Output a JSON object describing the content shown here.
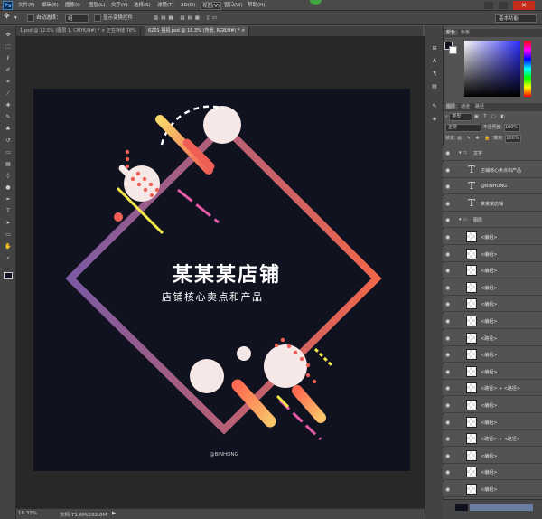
{
  "menubar": {
    "logo": "Ps",
    "items": [
      "文件(F)",
      "编辑(E)",
      "图像(I)",
      "图层(L)",
      "文字(Y)",
      "选择(S)",
      "滤镜(T)",
      "3D(D)",
      "视图(V)",
      "窗口(W)",
      "帮助(H)"
    ],
    "active_index": 8,
    "close": "✕"
  },
  "options": {
    "auto_select_label": "自动选择：",
    "auto_select_value": "组",
    "show_transform_label": "显示变换控件",
    "workspace": "基本功能"
  },
  "tabs": [
    {
      "label": "1.psd @ 12.5% (图层 1, CMYK/8#) * ×",
      "active": false
    },
    {
      "label": "正在存储 78%",
      "active": false
    },
    {
      "label": "6201 招招.psd @ 18.3% (背景, RGB/8#) * ×",
      "active": true
    }
  ],
  "status": {
    "zoom": "18.33%",
    "doc": "文档:71.6M/282.8M",
    "arrow": "▶"
  },
  "artwork": {
    "title": "某某某店铺",
    "subtitle": "店铺核心卖点和产品",
    "brand": "@BINHONG"
  },
  "colors": {
    "artwork_bg": "#101220",
    "gradient_start": "#7b5aa3",
    "gradient_end": "#f0664a",
    "accent_yellow": "#f4e84a",
    "accent_pink": "#e85aa8",
    "accent_coral": "#ef5f55",
    "circle_fill": "#f6e8e6"
  },
  "panels": {
    "color_tabs": [
      "颜色",
      "色板"
    ],
    "layers_tabs": [
      "图层",
      "通道",
      "路径"
    ],
    "kind_filter": "类型",
    "blend_mode": "正常",
    "opacity_label": "不透明度:",
    "opacity_value": "100%",
    "lock_label": "锁定:",
    "fill_label": "填充:",
    "fill_value": "100%"
  },
  "layers": [
    {
      "name": "文字",
      "type": "group"
    },
    {
      "name": "店铺核心卖点和产品",
      "type": "text"
    },
    {
      "name": "@BINHONG",
      "type": "text"
    },
    {
      "name": "某某某店铺",
      "type": "text"
    },
    {
      "name": "图层",
      "type": "group"
    },
    {
      "name": "<编组>",
      "type": "shape"
    },
    {
      "name": "<编组>",
      "type": "shape"
    },
    {
      "name": "<编组>",
      "type": "shape"
    },
    {
      "name": "<编组>",
      "type": "shape"
    },
    {
      "name": "<编组>",
      "type": "shape"
    },
    {
      "name": "<编组>",
      "type": "shape"
    },
    {
      "name": "<路径>",
      "type": "shape"
    },
    {
      "name": "<编组>",
      "type": "shape"
    },
    {
      "name": "<编组>",
      "type": "shape"
    },
    {
      "name": "<路径> + <路径>",
      "type": "shape"
    },
    {
      "name": "<编组>",
      "type": "shape"
    },
    {
      "name": "<编组>",
      "type": "shape"
    },
    {
      "name": "<路径> + <路径>",
      "type": "shape"
    },
    {
      "name": "<编组>",
      "type": "shape"
    },
    {
      "name": "<编组>",
      "type": "shape"
    },
    {
      "name": "<编组>",
      "type": "shape"
    }
  ],
  "toolbox_icons": [
    "move-icon",
    "marquee-icon",
    "lasso-icon",
    "quick-select-icon",
    "crop-icon",
    "eyedropper-icon",
    "healing-icon",
    "brush-icon",
    "stamp-icon",
    "history-brush-icon",
    "eraser-icon",
    "gradient-icon",
    "blur-icon",
    "dodge-icon",
    "pen-icon",
    "type-icon",
    "path-select-icon",
    "shape-icon",
    "hand-icon",
    "zoom-icon"
  ]
}
